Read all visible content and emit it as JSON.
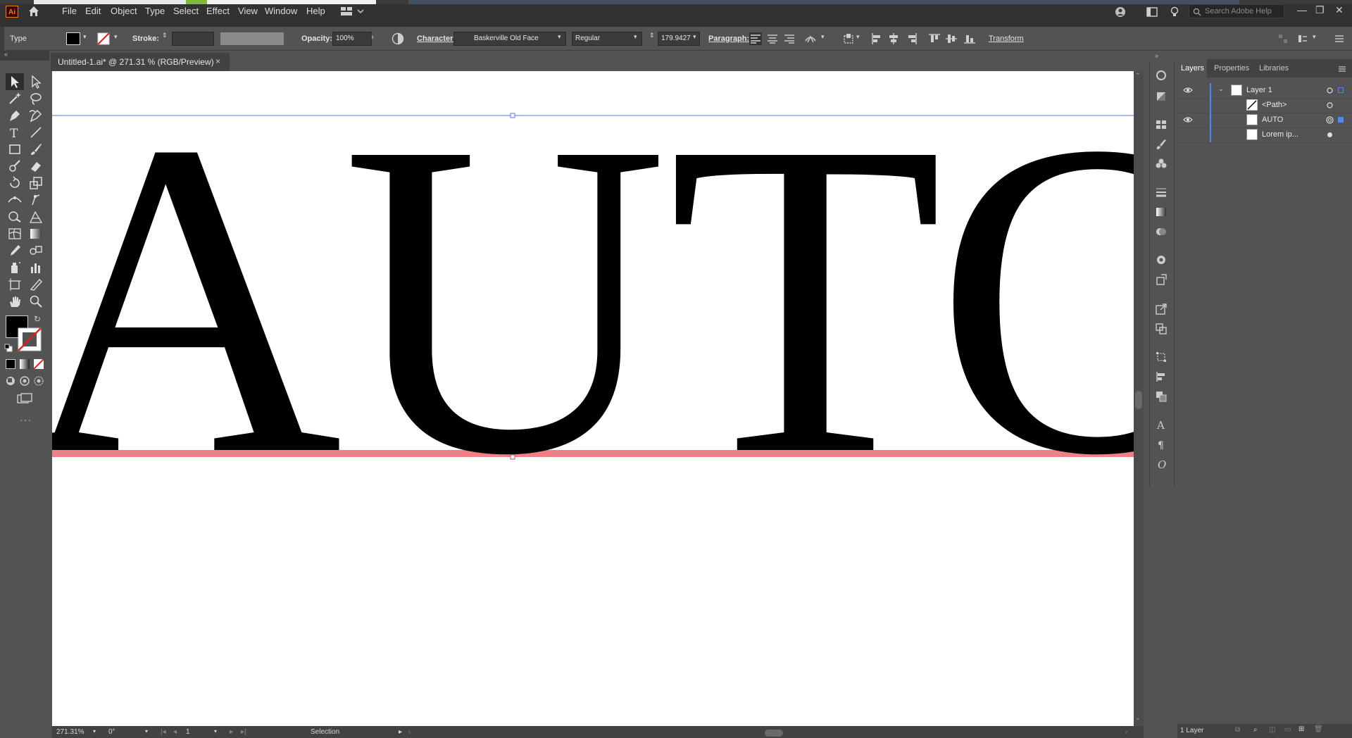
{
  "app": {
    "logo_text": "Ai",
    "menu": [
      "File",
      "Edit",
      "Object",
      "Type",
      "Select",
      "Effect",
      "View",
      "Window",
      "Help"
    ],
    "search_placeholder": "Search Adobe Help"
  },
  "control_bar": {
    "tool_name": "Type",
    "stroke_label": "Stroke:",
    "opacity_label": "Opacity:",
    "opacity_value": "100%",
    "character_label": "Character:",
    "font_family": "Baskerville Old Face",
    "font_style": "Regular",
    "font_size": "179.9427",
    "paragraph_label": "Paragraph:",
    "transform_label": "Transform"
  },
  "document": {
    "tab_title": "Untitled-1.ai* @ 271.31 % (RGB/Preview)",
    "close_glyph": "×",
    "artwork_text": "AUTO"
  },
  "status_bar": {
    "zoom": "271.31%",
    "rotation": "0°",
    "artboard": "1",
    "tool": "Selection"
  },
  "layers_panel": {
    "tabs": [
      "Layers",
      "Properties",
      "Libraries"
    ],
    "rows": [
      {
        "name": "Layer 1",
        "visible": true
      },
      {
        "name": "<Path>",
        "visible": false
      },
      {
        "name": "AUTO",
        "visible": true
      },
      {
        "name": "Lorem ip...",
        "visible": false
      }
    ],
    "footer": "1 Layer"
  },
  "colors": {
    "ui_dark": "#323232",
    "ui_mid": "#535353",
    "selection_guide": "#4b7bd6",
    "baseline_highlight": "#f08088",
    "layer_accent": "#4b86ff"
  }
}
